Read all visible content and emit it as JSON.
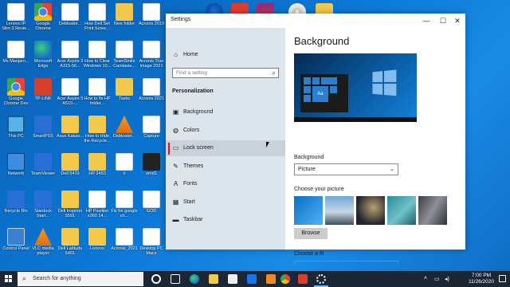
{
  "desktop": {
    "icons": [
      {
        "label": "Lenovo IP Slim 3 Revie...",
        "kind": "doc"
      },
      {
        "label": "Google Chrome",
        "kind": "chrome"
      },
      {
        "label": "Debloater...",
        "kind": "doc"
      },
      {
        "label": "How Dell Set Print Scree...",
        "kind": "doc"
      },
      {
        "label": "New folder",
        "kind": "folder"
      },
      {
        "label": "Acronis 2019",
        "kind": "doc"
      },
      {
        "label": "Ms Manjaro...",
        "kind": "doc"
      },
      {
        "label": "Microsoft Edge",
        "kind": "edge"
      },
      {
        "label": "Acer Aspire 3 A315-56...",
        "kind": "doc"
      },
      {
        "label": "How to Clear Windows 10...",
        "kind": "doc"
      },
      {
        "label": "TeamSmile Camtasia...",
        "kind": "doc"
      },
      {
        "label": "Acronis True Image 2021",
        "kind": "doc"
      },
      {
        "label": "Google Chrome Dev",
        "kind": "chrome"
      },
      {
        "label": "TP-LINK",
        "kind": "red"
      },
      {
        "label": "Acer Aspire 5 A515-...",
        "kind": "doc"
      },
      {
        "label": "How to fix HP folder...",
        "kind": "doc"
      },
      {
        "label": "Tasks",
        "kind": "folder"
      },
      {
        "label": "Acronis 2021",
        "kind": "doc"
      },
      {
        "label": "This PC",
        "kind": "pc"
      },
      {
        "label": "SmartPSS",
        "kind": "blue"
      },
      {
        "label": "Asus Kakao...",
        "kind": "folder"
      },
      {
        "label": "How to Hide the Recycle...",
        "kind": "folder"
      },
      {
        "label": "Debloater...",
        "kind": "orange"
      },
      {
        "label": "Capture",
        "kind": "doc"
      },
      {
        "label": "Network",
        "kind": "net"
      },
      {
        "label": "TeamViewer",
        "kind": "blue"
      },
      {
        "label": "Dell 5410",
        "kind": "folder"
      },
      {
        "label": "HP 2450",
        "kind": "folder"
      },
      {
        "label": "ri",
        "kind": "doc"
      },
      {
        "label": "emd1",
        "kind": "dark"
      },
      {
        "label": "Recycle Bin",
        "kind": "blue"
      },
      {
        "label": "Stardock Start...",
        "kind": "blue"
      },
      {
        "label": "Dell Inspiron 5591",
        "kind": "folder"
      },
      {
        "label": "HP Pavilion x360 14...",
        "kind": "doc"
      },
      {
        "label": "Fix for google ch...",
        "kind": "doc"
      },
      {
        "label": "GOD",
        "kind": "doc"
      },
      {
        "label": "Control Panel",
        "kind": "cp"
      },
      {
        "label": "VLC media player",
        "kind": "orange"
      },
      {
        "label": "Dell Latitude 5401",
        "kind": "folder"
      },
      {
        "label": "Lenovo",
        "kind": "folder"
      },
      {
        "label": "Acronis_2021",
        "kind": "doc"
      },
      {
        "label": "Desktop PC Macs",
        "kind": "doc"
      }
    ]
  },
  "window": {
    "title": "Settings",
    "controls": {
      "minimize": "—",
      "maximize": "☐",
      "close": "✕"
    },
    "nav": {
      "home": "Home",
      "search_placeholder": "Find a setting",
      "section": "Personalization",
      "items": [
        {
          "label": "Background",
          "icon": "image-icon",
          "glyph": "▣"
        },
        {
          "label": "Colors",
          "icon": "palette-icon",
          "glyph": "◍"
        },
        {
          "label": "Lock screen",
          "icon": "lock-screen-icon",
          "glyph": "▭",
          "selected": true
        },
        {
          "label": "Themes",
          "icon": "brush-icon",
          "glyph": "✎"
        },
        {
          "label": "Fonts",
          "icon": "font-icon",
          "glyph": "A"
        },
        {
          "label": "Start",
          "icon": "start-icon",
          "glyph": "▦"
        },
        {
          "label": "Taskbar",
          "icon": "taskbar-icon",
          "glyph": "▬"
        }
      ]
    },
    "content": {
      "heading": "Background",
      "preview_label": "Aa",
      "background_label": "Background",
      "background_value": "Picture",
      "choose_picture_label": "Choose your picture",
      "browse_label": "Browse",
      "choose_fit_label": "Choose a fit"
    }
  },
  "taskbar": {
    "search_placeholder": "Search for anything",
    "time": "7:00 PM",
    "date": "11/26/2020"
  }
}
